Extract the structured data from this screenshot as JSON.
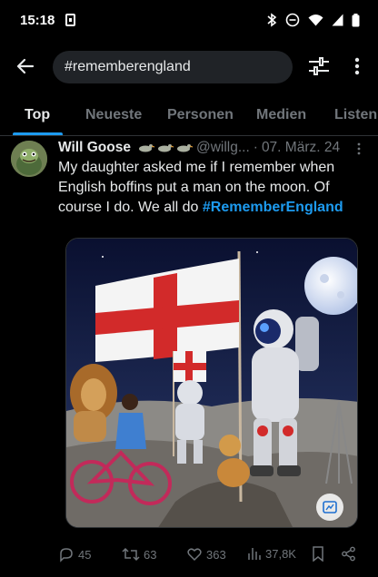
{
  "status_bar": {
    "time": "15:18"
  },
  "search": {
    "query": "#rememberengland"
  },
  "tabs": [
    {
      "label": "Top",
      "active": true
    },
    {
      "label": "Neueste",
      "active": false
    },
    {
      "label": "Personen",
      "active": false
    },
    {
      "label": "Medien",
      "active": false
    },
    {
      "label": "Listen",
      "active": false
    }
  ],
  "tweet": {
    "author_name": "Will Goose",
    "handle": "@willg...",
    "separator": "·",
    "date": "07. März. 24",
    "text": "My daughter asked me if I remember when English boffins put a man on the moon. Of course I do. We all do",
    "hashtag": "#RememberEngland",
    "replies": "45",
    "retweets": "63",
    "likes": "363",
    "views": "37,8K"
  },
  "colors": {
    "accent": "#1d9bf0",
    "background": "#000000",
    "muted": "#71767b"
  }
}
